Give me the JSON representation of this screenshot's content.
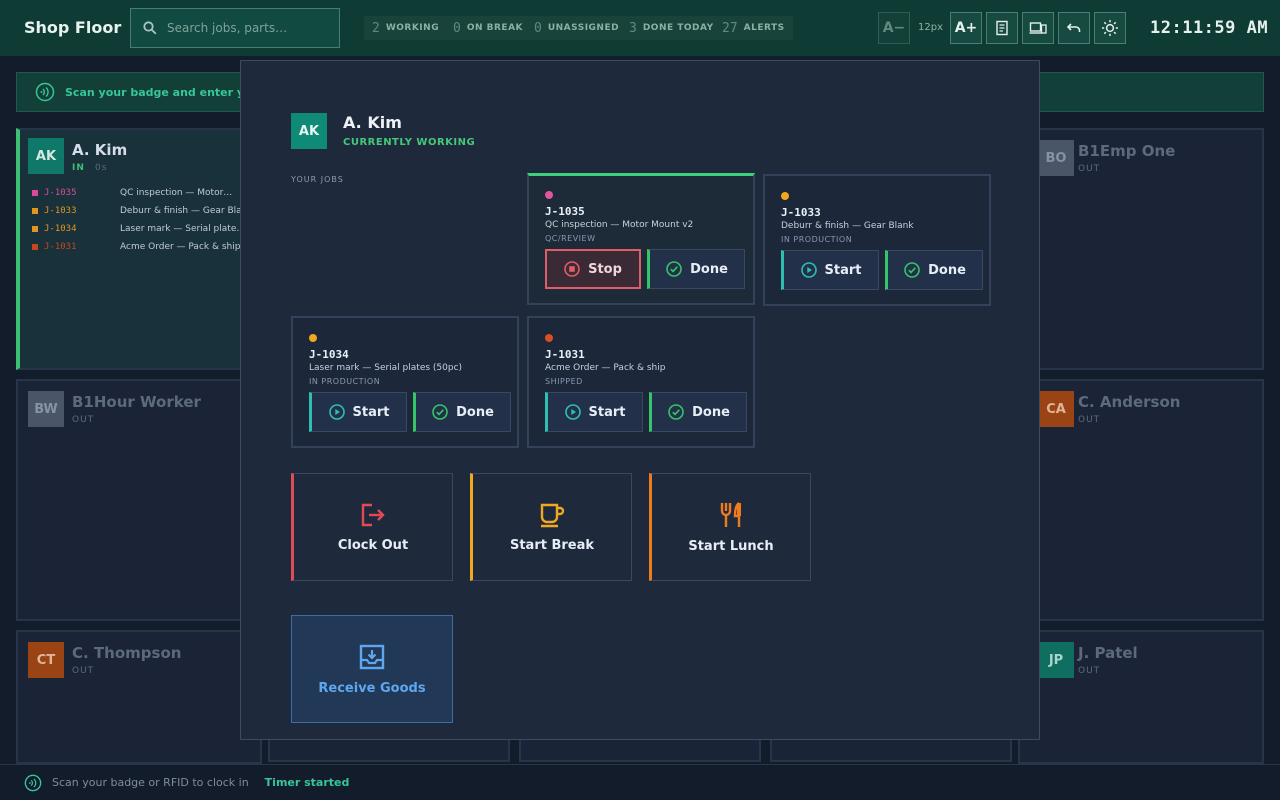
{
  "header": {
    "title": "Shop Floor",
    "search_placeholder": "Search jobs, parts…",
    "stats": [
      {
        "count": "2",
        "label": "WORKING"
      },
      {
        "count": "0",
        "label": "ON BREAK"
      },
      {
        "count": "0",
        "label": "UNASSIGNED"
      },
      {
        "count": "3",
        "label": "DONE TODAY"
      },
      {
        "count": "27",
        "label": "ALERTS"
      }
    ],
    "font_decrease": "A−",
    "font_size": "12px",
    "font_increase": "A+",
    "clock": "12:11:59 AM"
  },
  "banner": {
    "text": "Scan your badge and enter your P"
  },
  "cards": [
    {
      "initials": "AK",
      "name": "A. Kim",
      "status": "IN",
      "elapsed": "0s",
      "jobs": [
        {
          "id": "J-1035",
          "title": "QC inspection — Motor…",
          "color": "#d94a9a"
        },
        {
          "id": "J-1033",
          "title": "Deburr & finish — Gear Bla…",
          "color": "#e0961f"
        },
        {
          "id": "J-1034",
          "title": "Laser mark — Serial plate…",
          "color": "#e0961f"
        },
        {
          "id": "J-1031",
          "title": "Acme Order — Pack & ship",
          "color": "#c8461f"
        }
      ]
    },
    {
      "initials": "BO",
      "name": "B1Emp One",
      "status": "OUT"
    },
    {
      "initials": "BW",
      "name": "B1Hour Worker",
      "status": "OUT"
    },
    {
      "initials": "CA",
      "name": "C. Anderson",
      "status": "OUT"
    },
    {
      "initials": "CT",
      "name": "C. Thompson",
      "status": "OUT"
    },
    {
      "initials": "JP",
      "name": "J. Patel",
      "status": "OUT"
    }
  ],
  "modal": {
    "initials": "AK",
    "name": "A. Kim",
    "status": "CURRENTLY WORKING",
    "section_label": "YOUR JOBS",
    "jobs": [
      {
        "id": "J-1035",
        "title": "QC inspection — Motor Mount v2",
        "status": "QC/REVIEW",
        "dot": "#e0559e",
        "primary": "Stop",
        "secondary": "Done"
      },
      {
        "id": "J-1033",
        "title": "Deburr & finish — Gear Blank",
        "status": "IN PRODUCTION",
        "dot": "#f0a81f",
        "primary": "Start",
        "secondary": "Done"
      },
      {
        "id": "J-1034",
        "title": "Laser mark — Serial plates (50pc)",
        "status": "IN PRODUCTION",
        "dot": "#f0a81f",
        "primary": "Start",
        "secondary": "Done"
      },
      {
        "id": "J-1031",
        "title": "Acme Order — Pack & ship",
        "status": "SHIPPED",
        "dot": "#d8501f",
        "primary": "Start",
        "secondary": "Done"
      }
    ],
    "actions": {
      "clock_out": "Clock Out",
      "start_break": "Start Break",
      "start_lunch": "Start Lunch",
      "receive_goods": "Receive Goods"
    }
  },
  "footer": {
    "hint": "Scan your badge or RFID to clock in",
    "message": "Timer started"
  },
  "colors": {
    "accent": "#0f8a76",
    "working": "#3fcf7d",
    "stop": "#e05c67",
    "break": "#f0a81f",
    "lunch": "#f07a1e",
    "receive": "#5ea7f0"
  }
}
